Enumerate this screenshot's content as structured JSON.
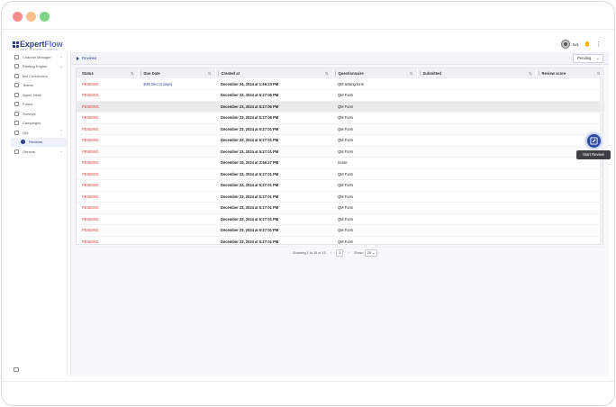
{
  "app": {
    "logo_main": "Expert",
    "logo_accent": "Flow",
    "logo_subtitle": "your customer experts"
  },
  "header": {
    "user_name": "tw1"
  },
  "sidebar": {
    "items": [
      {
        "label": "Channel Manager",
        "icon": "grid-icon",
        "chevron": "⌄"
      },
      {
        "label": "Routing Engine",
        "icon": "filter-icon",
        "chevron": "⌄"
      },
      {
        "label": "Bot Connectors",
        "icon": "bot-icon"
      },
      {
        "label": "Teams",
        "icon": "team-icon"
      },
      {
        "label": "Agent Desk",
        "icon": "headset-icon"
      },
      {
        "label": "Forms",
        "icon": "form-icon"
      },
      {
        "label": "Surveys",
        "icon": "survey-icon"
      },
      {
        "label": "Campaigns",
        "icon": "campaign-icon"
      },
      {
        "label": "QM",
        "icon": "qm-icon",
        "chevron": "⌃"
      },
      {
        "label": "Reviews",
        "icon": "review-icon"
      },
      {
        "label": "General",
        "icon": "gear-icon",
        "chevron": "⌄"
      }
    ]
  },
  "main": {
    "breadcrumb": "Reviews",
    "filter_value": "Pending",
    "columns": [
      "Status",
      "Due Date",
      "Created at",
      "Questionnaire",
      "Submitted",
      "Review score"
    ],
    "rows": [
      {
        "status": "PENDING",
        "due": "30th Dec (4 days)",
        "created": "December 24, 2024 at 1:56:23 PM",
        "questionnaire": "QM testing form",
        "submitted": "",
        "score": ""
      },
      {
        "status": "PENDING",
        "due": "",
        "created": "December 23, 2024 at 5:27:06 PM",
        "questionnaire": "QM Form",
        "submitted": "",
        "score": ""
      },
      {
        "status": "PENDING",
        "due": "",
        "created": "December 23, 2024 at 5:27:06 PM",
        "questionnaire": "QM Form",
        "submitted": "",
        "score": ""
      },
      {
        "status": "PENDING",
        "due": "",
        "created": "December 23, 2024 at 5:27:06 PM",
        "questionnaire": "QM Form",
        "submitted": "",
        "score": ""
      },
      {
        "status": "PENDING",
        "due": "",
        "created": "December 23, 2024 at 5:27:01 PM",
        "questionnaire": "QM Form",
        "submitted": "",
        "score": ""
      },
      {
        "status": "PENDING",
        "due": "",
        "created": "December 23, 2024 at 5:27:01 PM",
        "questionnaire": "QM Form",
        "submitted": "",
        "score": ""
      },
      {
        "status": "PENDING",
        "due": "",
        "created": "December 23, 2024 at 5:27:01 PM",
        "questionnaire": "QM Form",
        "submitted": "",
        "score": ""
      },
      {
        "status": "PENDING",
        "due": "",
        "created": "December 19, 2024 at 3:56:27 PM",
        "questionnaire": "Score",
        "submitted": "",
        "score": ""
      },
      {
        "status": "PENDING",
        "due": "",
        "created": "December 23, 2024 at 5:27:01 PM",
        "questionnaire": "QM Form",
        "submitted": "",
        "score": ""
      },
      {
        "status": "PENDING",
        "due": "",
        "created": "December 23, 2024 at 5:27:01 PM",
        "questionnaire": "QM Form",
        "submitted": "",
        "score": ""
      },
      {
        "status": "PENDING",
        "due": "",
        "created": "December 23, 2024 at 5:27:01 PM",
        "questionnaire": "QM Form",
        "submitted": "",
        "score": ""
      },
      {
        "status": "PENDING",
        "due": "",
        "created": "December 23, 2024 at 5:27:01 PM",
        "questionnaire": "QM Form",
        "submitted": "",
        "score": ""
      },
      {
        "status": "PENDING",
        "due": "",
        "created": "December 23, 2024 at 5:27:01 PM",
        "questionnaire": "QM Form",
        "submitted": "",
        "score": ""
      },
      {
        "status": "PENDING",
        "due": "",
        "created": "December 23, 2024 at 5:27:01 PM",
        "questionnaire": "QM Form",
        "submitted": "",
        "score": ""
      },
      {
        "status": "PENDING",
        "due": "",
        "created": "December 23, 2024 at 5:27:01 PM",
        "questionnaire": "QM Form",
        "submitted": "",
        "score": ""
      }
    ],
    "pager": {
      "summary": "Showing 1 to 15 of 15",
      "current_page": "1",
      "show_label": "Show",
      "page_size": "25"
    },
    "start_review_tooltip": "Start Review"
  },
  "colors": {
    "brand": "#2c3f8c",
    "pending": "#d73b3b",
    "fab": "#2d4aa0"
  }
}
